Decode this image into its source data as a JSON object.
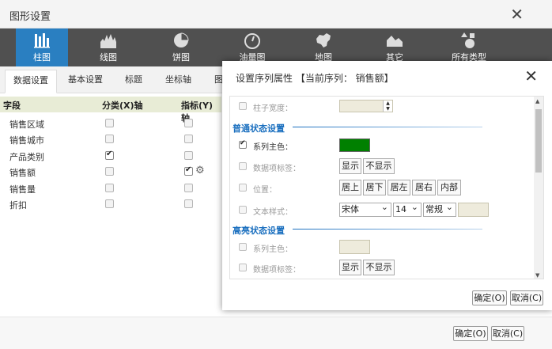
{
  "outer": {
    "title": "图形设置",
    "close_glyph": "✕",
    "chart_types": [
      {
        "label": "柱图",
        "icon": "bar-chart-icon"
      },
      {
        "label": "线图",
        "icon": "line-chart-icon"
      },
      {
        "label": "饼图",
        "icon": "pie-chart-icon"
      },
      {
        "label": "油量图",
        "icon": "gauge-icon"
      },
      {
        "label": "地图",
        "icon": "china-map-icon"
      },
      {
        "label": "其它",
        "icon": "area-chart-icon"
      },
      {
        "label": "所有类型",
        "icon": "shapes-icon"
      }
    ],
    "tabs": [
      "数据设置",
      "基本设置",
      "标题",
      "坐标轴",
      "图"
    ],
    "grid": {
      "headers": [
        "字段",
        "分类(X)轴",
        "指标(Y)轴"
      ],
      "rows": [
        {
          "field": "销售区域",
          "x": false,
          "y": false
        },
        {
          "field": "销售城市",
          "x": false,
          "y": false
        },
        {
          "field": "产品类别",
          "x": true,
          "y": false
        },
        {
          "field": "销售额",
          "x": false,
          "y": true
        },
        {
          "field": "销售量",
          "x": false,
          "y": false
        },
        {
          "field": "折扣",
          "x": false,
          "y": false
        }
      ]
    },
    "ok": "确定(O)",
    "cancel": "取消(C)"
  },
  "modal": {
    "title": "设置序列属性 【当前序列：  销售额】",
    "close_glyph": "✕",
    "column_width": {
      "label": "柱子宽度：",
      "checked": false
    },
    "normal_section": "普通状态设置",
    "normal": {
      "series_color": {
        "label": "系列主色：",
        "checked": true,
        "color": "#008000"
      },
      "data_label": {
        "label": "数据项标签：",
        "checked": false,
        "options": [
          "显示",
          "不显示"
        ]
      },
      "position": {
        "label": "位置：",
        "checked": false,
        "options": [
          "居上",
          "居下",
          "居左",
          "居右",
          "内部"
        ]
      },
      "text_style": {
        "label": "文本样式：",
        "checked": false,
        "font": "宋体",
        "size": "14",
        "weight": "常规"
      }
    },
    "highlight_section": "高亮状态设置",
    "highlight": {
      "series_color": {
        "label": "系列主色：",
        "checked": false
      },
      "data_label": {
        "label": "数据项标签：",
        "checked": false,
        "options": [
          "显示",
          "不显示"
        ]
      }
    },
    "ok": "确定(O)",
    "cancel": "取消(C)",
    "accent": "#1a6fbf",
    "active_tab_color": "#2a7fc1"
  }
}
